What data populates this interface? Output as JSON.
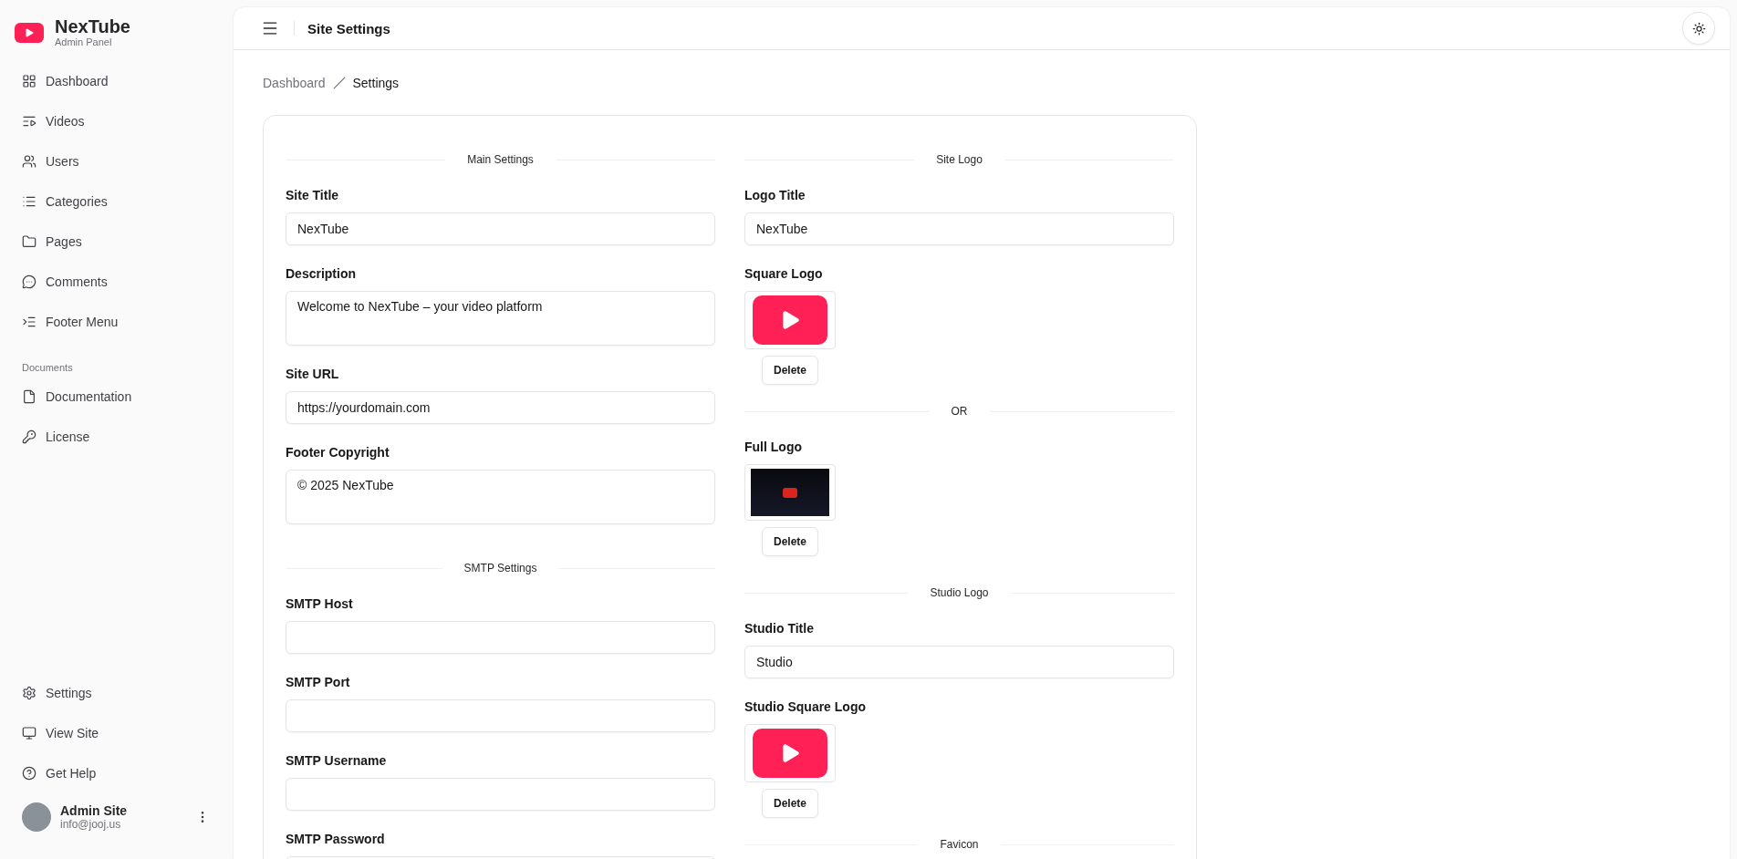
{
  "sidebar": {
    "brand": {
      "name": "NexTube",
      "subtitle": "Admin Panel"
    },
    "nav": [
      {
        "label": "Dashboard"
      },
      {
        "label": "Videos"
      },
      {
        "label": "Users"
      },
      {
        "label": "Categories"
      },
      {
        "label": "Pages"
      },
      {
        "label": "Comments"
      },
      {
        "label": "Footer Menu"
      }
    ],
    "documents": {
      "heading": "Documents",
      "items": [
        {
          "label": "Documentation"
        },
        {
          "label": "License"
        }
      ]
    },
    "bottom_nav": [
      {
        "label": "Settings"
      },
      {
        "label": "View Site"
      },
      {
        "label": "Get Help"
      }
    ],
    "user": {
      "name": "Admin Site",
      "email": "info@jooj.us"
    }
  },
  "header": {
    "title": "Site Settings"
  },
  "breadcrumbs": [
    {
      "label": "Dashboard",
      "current": false
    },
    {
      "label": "Settings",
      "current": true
    }
  ],
  "form": {
    "left": [
      {
        "title": "Main Settings",
        "fields": [
          {
            "kind": "input",
            "label": "Site Title",
            "value": "NexTube"
          },
          {
            "kind": "textarea",
            "label": "Description",
            "value": "Welcome to NexTube – your video platform"
          },
          {
            "kind": "input",
            "label": "Site URL",
            "value": "https://yourdomain.com"
          },
          {
            "kind": "textarea",
            "label": "Footer Copyright",
            "value": "© 2025 NexTube"
          }
        ]
      },
      {
        "title": "SMTP Settings",
        "fields": [
          {
            "kind": "input",
            "label": "SMTP Host"
          },
          {
            "kind": "input",
            "label": "SMTP Port"
          },
          {
            "kind": "input",
            "label": "SMTP Username"
          },
          {
            "kind": "input",
            "label": "SMTP Password"
          }
        ]
      }
    ],
    "right": [
      {
        "title": "Site Logo",
        "fields": [
          {
            "kind": "input",
            "label": "Logo Title",
            "value": "NexTube"
          },
          {
            "kind": "image_square",
            "label": "Square Logo",
            "button": "Delete"
          }
        ]
      },
      {
        "title": "OR",
        "fields": [
          {
            "kind": "image_wide",
            "label": "Full Logo",
            "button": "Delete"
          }
        ]
      },
      {
        "title": "Studio Logo",
        "fields": [
          {
            "kind": "input",
            "label": "Studio Title",
            "value": "Studio"
          },
          {
            "kind": "image_square",
            "label": "Studio Square Logo",
            "button": "Delete"
          }
        ]
      },
      {
        "title": "Favicon"
      }
    ]
  }
}
